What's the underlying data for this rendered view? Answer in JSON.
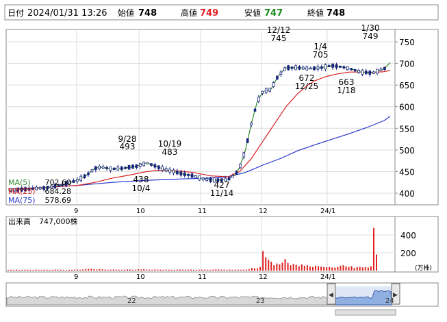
{
  "header": {
    "date_label": "日付",
    "datetime": "2024/01/31 13:26",
    "open_label": "始値",
    "open_value": "748",
    "high_label": "高値",
    "high_value": "749",
    "low_label": "安値",
    "low_value": "747",
    "close_label": "終値",
    "close_value": "748"
  },
  "price_panel": {
    "y_ticks": [
      "750",
      "700",
      "650",
      "600",
      "550",
      "500",
      "450",
      "400"
    ],
    "x_ticks": [
      "9",
      "10",
      "11",
      "12",
      "24/1"
    ],
    "legend": [
      {
        "label": "MA(5)",
        "value": "702.60",
        "color": "#2e8b2e"
      },
      {
        "label": "MA(25)",
        "value": "684.28",
        "color": "#d92020"
      },
      {
        "label": "MA(75)",
        "value": "578.69",
        "color": "#2233cc"
      }
    ],
    "annotations": [
      {
        "date": "9/28",
        "value": "493"
      },
      {
        "date": "10/19",
        "value": "483"
      },
      {
        "value": "438",
        "date": "10/4"
      },
      {
        "value": "427",
        "date": "11/14"
      },
      {
        "date": "12/12",
        "value": "745"
      },
      {
        "date": "1/4",
        "value": "705"
      },
      {
        "value": "672",
        "date": "12/25"
      },
      {
        "value": "663",
        "date": "1/18"
      },
      {
        "date": "1/30",
        "value": "749"
      }
    ]
  },
  "volume_panel": {
    "label": "出来高",
    "value": "747,000株",
    "y_ticks": [
      "400",
      "200"
    ],
    "unit": "(万株)",
    "x_ticks": [
      "9",
      "10",
      "11",
      "12",
      "24/1"
    ]
  },
  "navigator": {
    "labels": [
      "22",
      "23",
      "24"
    ],
    "left_arrow": "◀",
    "right_arrow": "▶"
  },
  "colors": {
    "up": "#ffffff",
    "down": "#1a237e",
    "volume": "#e02020",
    "grid": "#dcdcdc",
    "border": "#888888",
    "ma5": "#2e8b2e",
    "ma25": "#d92020",
    "ma75": "#2233cc"
  },
  "chart_data": {
    "type": "candlestick",
    "y_range": [
      370,
      790
    ],
    "ma5": [
      [
        0,
        407
      ],
      [
        15,
        409
      ],
      [
        30,
        412
      ],
      [
        45,
        418
      ],
      [
        60,
        430
      ],
      [
        68,
        442
      ],
      [
        75,
        458
      ],
      [
        80,
        460
      ],
      [
        90,
        456
      ],
      [
        100,
        458
      ],
      [
        110,
        462
      ],
      [
        120,
        470
      ],
      [
        128,
        462
      ],
      [
        135,
        455
      ],
      [
        140,
        452
      ],
      [
        150,
        445
      ],
      [
        160,
        440
      ],
      [
        170,
        432
      ],
      [
        180,
        430
      ],
      [
        190,
        432
      ],
      [
        196,
        442
      ],
      [
        200,
        460
      ],
      [
        205,
        500
      ],
      [
        210,
        560
      ],
      [
        215,
        610
      ],
      [
        220,
        635
      ],
      [
        227,
        640
      ],
      [
        233,
        670
      ],
      [
        240,
        690
      ],
      [
        250,
        690
      ],
      [
        260,
        688
      ],
      [
        270,
        690
      ],
      [
        280,
        695
      ],
      [
        288,
        692
      ],
      [
        295,
        688
      ],
      [
        305,
        680
      ],
      [
        315,
        678
      ],
      [
        325,
        688
      ],
      [
        330,
        702
      ]
    ],
    "ma25": [
      [
        0,
        410
      ],
      [
        30,
        413
      ],
      [
        60,
        418
      ],
      [
        75,
        425
      ],
      [
        90,
        435
      ],
      [
        105,
        442
      ],
      [
        120,
        450
      ],
      [
        130,
        453
      ],
      [
        145,
        452
      ],
      [
        160,
        448
      ],
      [
        175,
        440
      ],
      [
        190,
        438
      ],
      [
        200,
        450
      ],
      [
        210,
        480
      ],
      [
        220,
        520
      ],
      [
        230,
        560
      ],
      [
        240,
        600
      ],
      [
        250,
        630
      ],
      [
        258,
        648
      ],
      [
        265,
        660
      ],
      [
        275,
        670
      ],
      [
        285,
        676
      ],
      [
        295,
        680
      ],
      [
        305,
        680
      ],
      [
        315,
        679
      ],
      [
        325,
        681
      ],
      [
        330,
        684
      ]
    ],
    "ma75": [
      [
        0,
        410
      ],
      [
        30,
        413
      ],
      [
        60,
        418
      ],
      [
        90,
        425
      ],
      [
        120,
        430
      ],
      [
        150,
        433
      ],
      [
        175,
        435
      ],
      [
        190,
        438
      ],
      [
        205,
        448
      ],
      [
        220,
        465
      ],
      [
        235,
        480
      ],
      [
        250,
        498
      ],
      [
        265,
        512
      ],
      [
        280,
        525
      ],
      [
        295,
        538
      ],
      [
        310,
        552
      ],
      [
        325,
        568
      ],
      [
        330,
        578
      ]
    ],
    "volume": [
      8,
      10,
      9,
      12,
      8,
      9,
      10,
      11,
      9,
      8,
      12,
      10,
      9,
      11,
      10,
      8,
      9,
      12,
      11,
      10,
      9,
      8,
      10,
      9,
      11,
      12,
      10,
      14,
      18,
      20,
      22,
      15,
      12,
      16,
      14,
      12,
      10,
      11,
      13,
      12,
      10,
      9,
      11,
      14,
      12,
      10,
      9,
      15,
      13,
      16,
      12,
      11,
      10,
      13,
      12,
      11,
      10,
      12,
      11,
      10,
      9,
      11,
      13,
      12,
      10,
      11,
      12,
      10,
      9,
      10,
      11,
      12,
      10,
      9,
      12,
      14,
      13,
      12,
      11,
      10,
      12,
      9,
      11,
      12,
      10,
      11,
      12,
      14,
      30,
      28,
      25,
      40,
      220,
      150,
      120,
      100,
      60,
      80,
      70,
      90,
      130,
      85,
      60,
      75,
      65,
      50,
      70,
      55,
      60,
      45,
      40,
      55,
      50,
      45,
      40,
      38,
      42,
      36,
      34,
      40,
      55,
      60,
      48,
      40,
      50,
      30,
      38,
      42,
      36,
      40,
      35,
      50,
      480,
      180
    ]
  }
}
